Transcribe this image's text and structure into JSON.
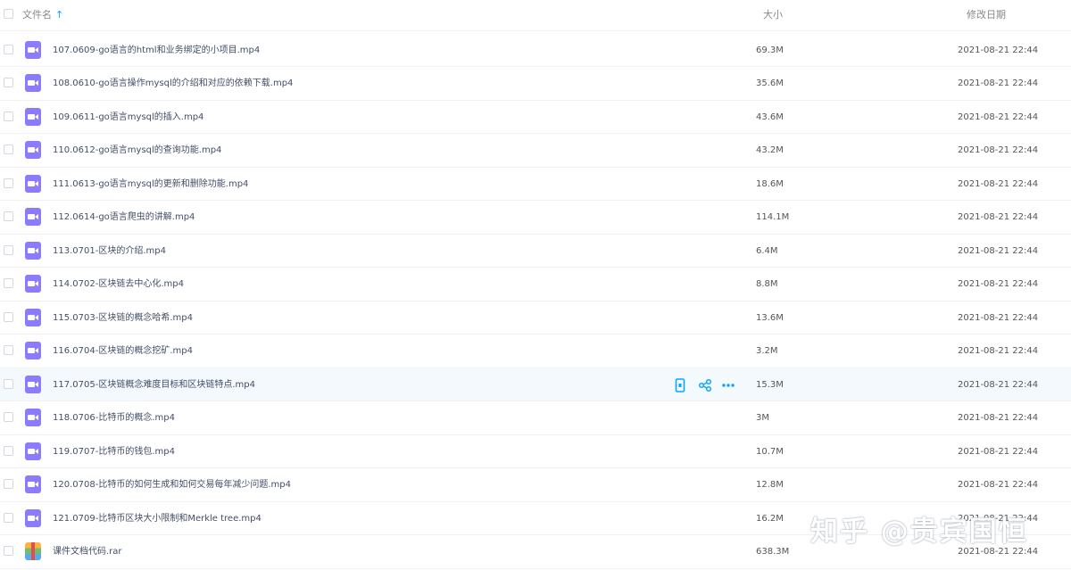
{
  "header": {
    "name_label": "文件名",
    "sort_icon": "arrow-up-icon",
    "size_label": "大小",
    "date_label": "修改日期"
  },
  "files": [
    {
      "name": "107.0609-go语言的html和业务绑定的小项目.mp4",
      "size": "69.3M",
      "date": "2021-08-21 22:44",
      "icon": "video-icon"
    },
    {
      "name": "108.0610-go语言操作mysql的介绍和对应的依赖下载.mp4",
      "size": "35.6M",
      "date": "2021-08-21 22:44",
      "icon": "video-icon"
    },
    {
      "name": "109.0611-go语言mysql的插入.mp4",
      "size": "43.6M",
      "date": "2021-08-21 22:44",
      "icon": "video-icon"
    },
    {
      "name": "110.0612-go语言mysql的查询功能.mp4",
      "size": "43.2M",
      "date": "2021-08-21 22:44",
      "icon": "video-icon"
    },
    {
      "name": "111.0613-go语言mysql的更新和删除功能.mp4",
      "size": "18.6M",
      "date": "2021-08-21 22:44",
      "icon": "video-icon"
    },
    {
      "name": "112.0614-go语言爬虫的讲解.mp4",
      "size": "114.1M",
      "date": "2021-08-21 22:44",
      "icon": "video-icon"
    },
    {
      "name": "113.0701-区块的介绍.mp4",
      "size": "6.4M",
      "date": "2021-08-21 22:44",
      "icon": "video-icon"
    },
    {
      "name": "114.0702-区块链去中心化.mp4",
      "size": "8.8M",
      "date": "2021-08-21 22:44",
      "icon": "video-icon"
    },
    {
      "name": "115.0703-区块链的概念哈希.mp4",
      "size": "13.6M",
      "date": "2021-08-21 22:44",
      "icon": "video-icon"
    },
    {
      "name": "116.0704-区块链的概念挖矿.mp4",
      "size": "3.2M",
      "date": "2021-08-21 22:44",
      "icon": "video-icon"
    },
    {
      "name": "117.0705-区块链概念难度目标和区块链特点.mp4",
      "size": "15.3M",
      "date": "2021-08-21 22:44",
      "icon": "video-icon",
      "hover": true
    },
    {
      "name": "118.0706-比特币的概念.mp4",
      "size": "3M",
      "date": "2021-08-21 22:44",
      "icon": "video-icon"
    },
    {
      "name": "119.0707-比特币的钱包.mp4",
      "size": "10.7M",
      "date": "2021-08-21 22:44",
      "icon": "video-icon"
    },
    {
      "name": "120.0708-比特币的如何生成和如何交易每年减少问题.mp4",
      "size": "12.8M",
      "date": "2021-08-21 22:44",
      "icon": "video-icon"
    },
    {
      "name": "121.0709-比特币区块大小限制和Merkle tree.mp4",
      "size": "16.2M",
      "date": "2021-08-21 22:44",
      "icon": "video-icon"
    },
    {
      "name": "课件文档代码.rar",
      "size": "638.3M",
      "date": "2021-08-21 22:44",
      "icon": "archive-icon"
    }
  ],
  "row_actions": [
    "phone-icon",
    "share-icon",
    "more-icon"
  ],
  "watermark": "知乎 @贵宾国恒",
  "colors": {
    "accent": "#06a7ff",
    "video_icon": "#8a7bff",
    "hover_row": "#f4f9fe"
  }
}
